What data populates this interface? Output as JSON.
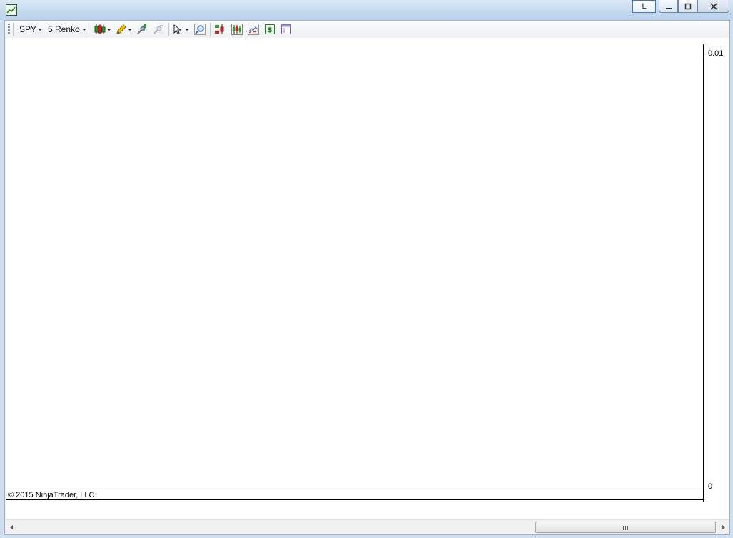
{
  "window": {
    "caption_button_l": "L",
    "icon": "chart-app-icon"
  },
  "toolbar": {
    "instrument": "SPY",
    "bar_type": "5 Renko",
    "icons": [
      "chart-style-icon",
      "drawing-pencil-icon",
      "add-indicator-icon",
      "remove-indicator-icon",
      "cursor-icon",
      "zoom-icon",
      "chart-trader-icon",
      "data-series-icon",
      "indicators-icon",
      "strategies-icon",
      "properties-icon"
    ]
  },
  "chart": {
    "y_axis_labels": [
      "0.01",
      "0"
    ],
    "copyright": "© 2015 NinjaTrader, LLC"
  },
  "scrollbar": {
    "thumb_icon": "scroll-grip-icon"
  }
}
